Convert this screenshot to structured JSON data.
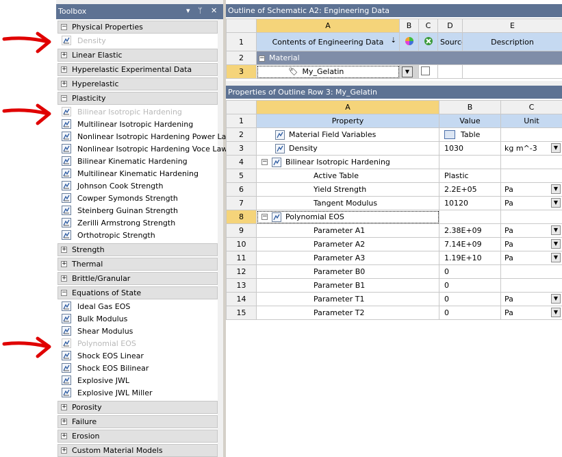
{
  "toolbox": {
    "title": "Toolbox",
    "controls": {
      "dropdown": "▾",
      "pin": "ᛘ",
      "close": "✕"
    },
    "sections": [
      {
        "id": "physical",
        "label": "Physical Properties",
        "expanded": true
      },
      {
        "id": "linear-elastic",
        "label": "Linear Elastic",
        "expanded": false
      },
      {
        "id": "hyper-exp",
        "label": "Hyperelastic Experimental Data",
        "expanded": false
      },
      {
        "id": "hyperelastic",
        "label": "Hyperelastic",
        "expanded": false
      },
      {
        "id": "plasticity",
        "label": "Plasticity",
        "expanded": true
      },
      {
        "id": "strength",
        "label": "Strength",
        "expanded": false
      },
      {
        "id": "thermal",
        "label": "Thermal",
        "expanded": false
      },
      {
        "id": "brittle",
        "label": "Brittle/Granular",
        "expanded": false
      },
      {
        "id": "eos",
        "label": "Equations of State",
        "expanded": true
      },
      {
        "id": "porosity",
        "label": "Porosity",
        "expanded": false
      },
      {
        "id": "failure",
        "label": "Failure",
        "expanded": false
      },
      {
        "id": "erosion",
        "label": "Erosion",
        "expanded": false
      },
      {
        "id": "custom",
        "label": "Custom Material Models",
        "expanded": false
      }
    ],
    "physical_items": [
      "Density"
    ],
    "plasticity_items": [
      "Bilinear Isotropic Hardening",
      "Multilinear Isotropic Hardening",
      "Nonlinear Isotropic Hardening Power Law",
      "Nonlinear Isotropic Hardening Voce Law",
      "Bilinear Kinematic Hardening",
      "Multilinear Kinematic Hardening",
      "Johnson Cook Strength",
      "Cowper Symonds Strength",
      "Steinberg Guinan Strength",
      "Zerilli Armstrong Strength",
      "Orthotropic Strength"
    ],
    "eos_items": [
      "Ideal Gas EOS",
      "Bulk Modulus",
      "Shear Modulus",
      "Polynomial EOS",
      "Shock EOS Linear",
      "Shock EOS Bilinear",
      "Explosive JWL",
      "Explosive JWL Miller"
    ]
  },
  "outline": {
    "title": "Outline of Schematic A2: Engineering Data",
    "col_letters": [
      "A",
      "B",
      "C",
      "D",
      "E"
    ],
    "header": {
      "contents": "Contents of Engineering Data",
      "source": "Source",
      "description": "Description"
    },
    "rows": [
      {
        "num": "1"
      },
      {
        "num": "2",
        "label": "Material"
      },
      {
        "num": "3",
        "label": "My_Gelatin"
      }
    ]
  },
  "properties": {
    "title": "Properties of Outline Row 3: My_Gelatin",
    "col_letters": [
      "A",
      "B",
      "C"
    ],
    "header": {
      "property": "Property",
      "value": "Value",
      "unit": "Unit"
    },
    "rows": [
      {
        "num": "2",
        "property": "Material Field Variables",
        "value": "Table",
        "unit": ""
      },
      {
        "num": "3",
        "property": "Density",
        "value": "1030",
        "unit": "kg m^-3"
      },
      {
        "num": "4",
        "property": "Bilinear Isotropic Hardening",
        "value": "",
        "unit": ""
      },
      {
        "num": "5",
        "property": "Active Table",
        "value": "Plastic",
        "unit": ""
      },
      {
        "num": "6",
        "property": "Yield Strength",
        "value": "2.2E+05",
        "unit": "Pa"
      },
      {
        "num": "7",
        "property": "Tangent Modulus",
        "value": "10120",
        "unit": "Pa"
      },
      {
        "num": "8",
        "property": "Polynomial EOS",
        "value": "",
        "unit": ""
      },
      {
        "num": "9",
        "property": "Parameter A1",
        "value": "2.38E+09",
        "unit": "Pa"
      },
      {
        "num": "10",
        "property": "Parameter A2",
        "value": "7.14E+09",
        "unit": "Pa"
      },
      {
        "num": "11",
        "property": "Parameter A3",
        "value": "1.19E+10",
        "unit": "Pa"
      },
      {
        "num": "12",
        "property": "Parameter B0",
        "value": "0",
        "unit": ""
      },
      {
        "num": "13",
        "property": "Parameter B1",
        "value": "0",
        "unit": ""
      },
      {
        "num": "14",
        "property": "Parameter T1",
        "value": "0",
        "unit": "Pa"
      },
      {
        "num": "15",
        "property": "Parameter T2",
        "value": "0",
        "unit": "Pa"
      }
    ],
    "header_num": "1"
  },
  "colors": {
    "titlebar": "#5d7293",
    "annotation_arrow": "#e00000",
    "header_blue": "#c5d9f1",
    "selected_col": "#f5d47a"
  }
}
